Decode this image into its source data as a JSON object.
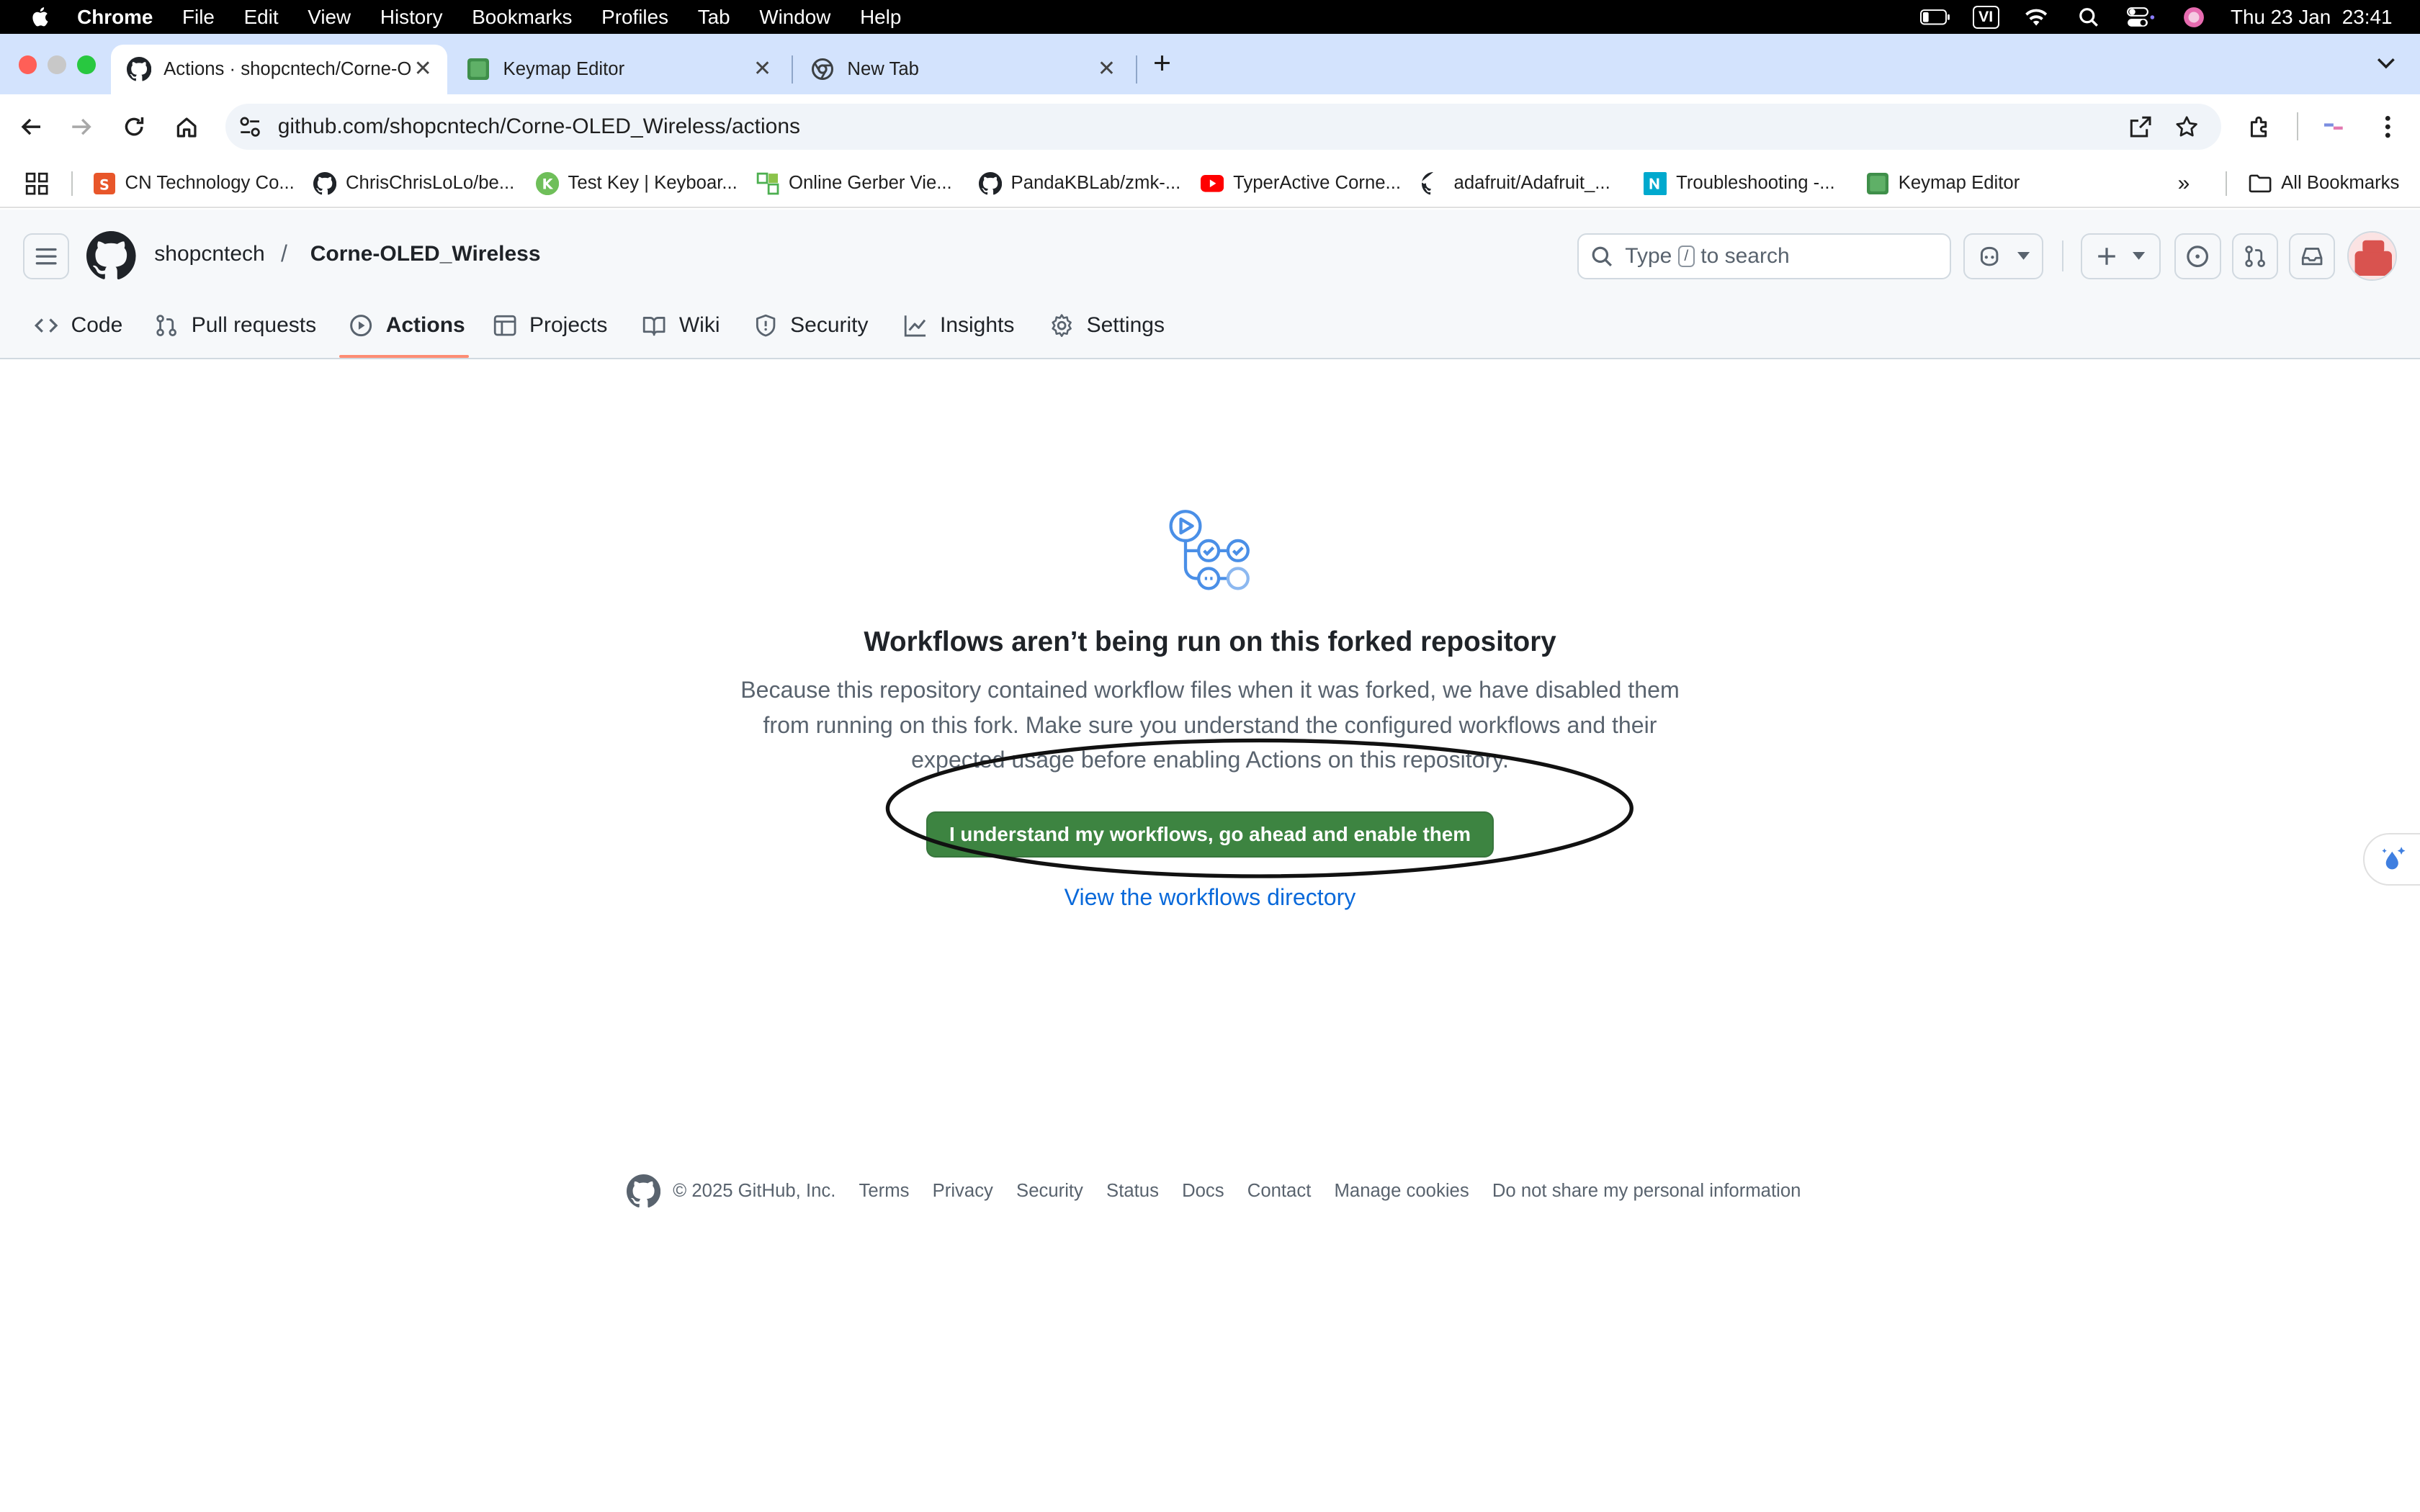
{
  "menubar": {
    "app": "Chrome",
    "items": [
      "File",
      "Edit",
      "View",
      "History",
      "Bookmarks",
      "Profiles",
      "Tab",
      "Window",
      "Help"
    ],
    "input_source": "VI",
    "datetime": "Thu 23 Jan  23:41"
  },
  "tabs": [
    {
      "title": "Actions · shopcntech/Corne-O",
      "icon": "github-icon"
    },
    {
      "title": "Keymap Editor",
      "icon": "keymap-icon"
    },
    {
      "title": "New Tab",
      "icon": "chrome-icon"
    }
  ],
  "address_bar": {
    "url": "github.com/shopcntech/Corne-OLED_Wireless/actions"
  },
  "bookmarks": {
    "items": [
      {
        "label": "CN Technology Co...",
        "icon": "shop-icon"
      },
      {
        "label": "ChrisChrisLoLo/be...",
        "icon": "github-icon"
      },
      {
        "label": "Test Key | Keyboar...",
        "icon": "keyboard-icon"
      },
      {
        "label": "Online Gerber Vie...",
        "icon": "gerber-icon"
      },
      {
        "label": "PandaKBLab/zmk-...",
        "icon": "github-icon"
      },
      {
        "label": "TyperActive Corne...",
        "icon": "youtube-icon"
      },
      {
        "label": "adafruit/Adafruit_...",
        "icon": "github-icon"
      },
      {
        "label": "Troubleshooting -...",
        "icon": "nrf-icon"
      },
      {
        "label": "Keymap Editor",
        "icon": "keymap-icon"
      }
    ],
    "all_bookmarks": "All Bookmarks"
  },
  "github": {
    "owner": "shopcntech",
    "separator": "/",
    "repo": "Corne-OLED_Wireless",
    "search_prefix": "Type",
    "search_key": "/",
    "search_suffix": "to search",
    "repo_tabs": [
      "Code",
      "Pull requests",
      "Actions",
      "Projects",
      "Wiki",
      "Security",
      "Insights",
      "Settings"
    ],
    "active_tab": "Actions"
  },
  "blankslate": {
    "title": "Workflows aren’t being run on this forked repository",
    "description": "Because this repository contained workflow files when it was forked, we have disabled them from running on this fork. Make sure you understand the configured workflows and their expected usage before enabling Actions on this repository.",
    "enable_button": "I understand my workflows, go ahead and enable them",
    "directory_link": "View the workflows directory"
  },
  "footer": {
    "copyright": "© 2025 GitHub, Inc.",
    "links": [
      "Terms",
      "Privacy",
      "Security",
      "Status",
      "Docs",
      "Contact",
      "Manage cookies",
      "Do not share my personal information"
    ]
  },
  "colors": {
    "primary_button": "#3d8441",
    "link": "#0969da",
    "active_tab_underline": "#fd8c73",
    "tabstrip": "#d3e3fd",
    "icon_blue": "#4a8fe7"
  }
}
